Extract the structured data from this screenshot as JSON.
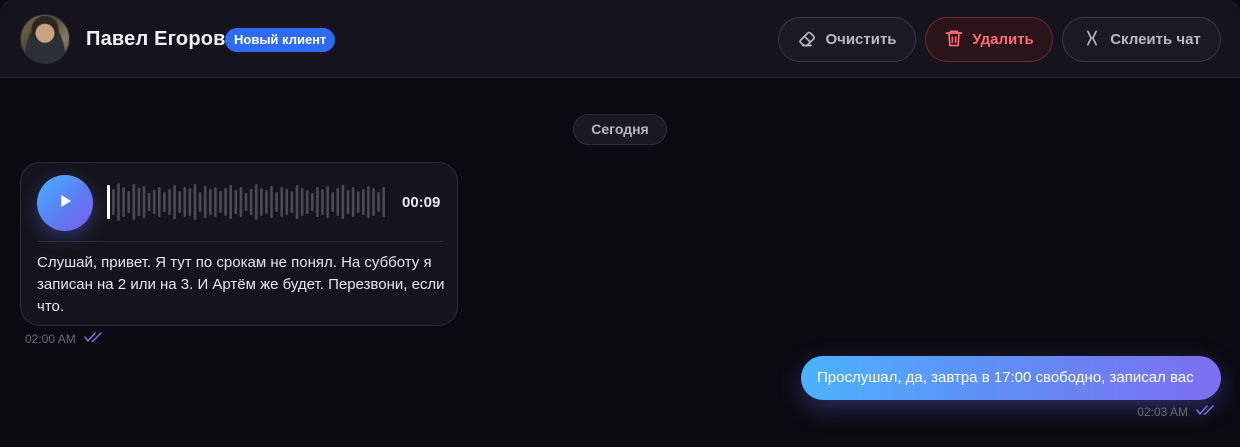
{
  "chat": {
    "contact_name": "Павел Егоров",
    "badge": "Новый клиент"
  },
  "actions": {
    "clear_label": "Очистить",
    "delete_label": "Удалить",
    "merge_label": "Склеить чат"
  },
  "date_separator": "Сегодня",
  "messages": [
    {
      "direction": "incoming",
      "type": "voice",
      "duration": "00:09",
      "transcript": "Слушай, привет. Я тут по срокам не понял. На субботу я записан на 2 или на 3. И Артём же будет. Перезвони, если что.",
      "time": "02:00 AM",
      "status_icon": "double-check-icon"
    },
    {
      "direction": "outgoing",
      "type": "text",
      "text": "Прослушал, да, завтра в 17:00 свободно, записал вас",
      "time": "02:03 AM",
      "status_icon": "double-check-icon"
    }
  ],
  "colors": {
    "accent_blue": "#2f6bf0",
    "delete_red": "#ff6a74",
    "bubble_gradient_start": "#4bb3ff",
    "bubble_gradient_end": "#7d6ff0",
    "check_color": "#7b73e8"
  }
}
